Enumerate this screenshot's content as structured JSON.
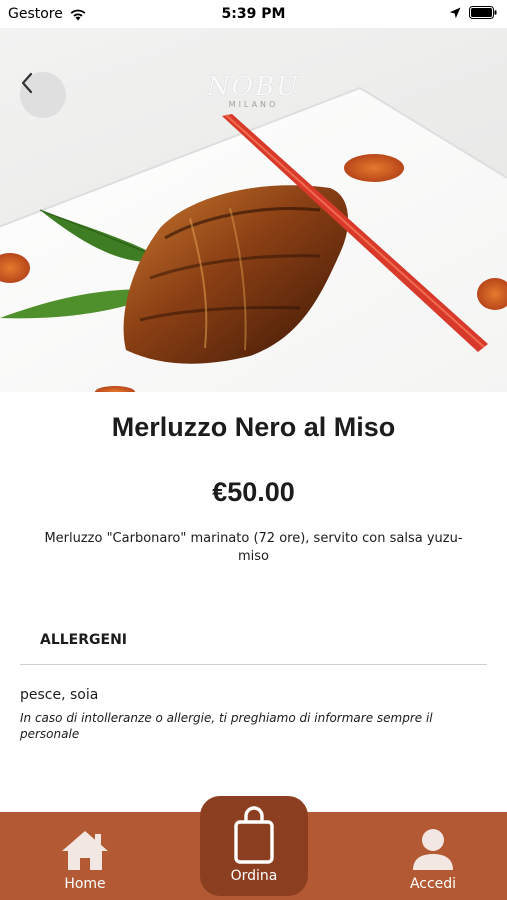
{
  "status_bar": {
    "carrier": "Gestore",
    "time": "5:39 PM",
    "icons": [
      "wifi-icon",
      "location-arrow-icon",
      "battery-icon"
    ]
  },
  "header": {
    "back_icon": "chevron-left-icon",
    "brand_name": "NOBU",
    "brand_sub": "MILANO"
  },
  "dish": {
    "title": "Merluzzo Nero al Miso",
    "price": "€50.00",
    "description": "Merluzzo \"Carbonaro\" marinato (72 ore), servito con salsa yuzu-miso"
  },
  "allergens": {
    "header": "ALLERGENI",
    "list": "pesce, soia",
    "note": "In caso di intolleranze o allergie, ti preghiamo di informare sempre il personale"
  },
  "tab_bar": {
    "home_label": "Home",
    "order_label": "Ordina",
    "login_label": "Accedi",
    "colors": {
      "bar": "#b35933",
      "active": "#8c3f20",
      "text": "#ffffff"
    }
  }
}
